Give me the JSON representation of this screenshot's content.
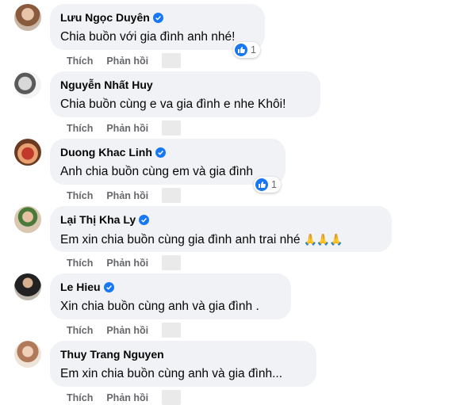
{
  "colors": {
    "bubble": "#f0f2f5",
    "verified": "#1877f2",
    "meta": "#65676b",
    "like": "#1877f2"
  },
  "actions": {
    "like": "Thích",
    "reply": "Phản hồi"
  },
  "comments": [
    {
      "name": "Lưu Ngọc Duyên",
      "verified": true,
      "text": "Chia buồn với gia đình anh nhé!",
      "reactions": "1",
      "emoji": ""
    },
    {
      "name": "Nguyễn Nhất Huy",
      "verified": false,
      "text": "Chia buồn cùng e va gia đình e nhe Khôi!",
      "reactions": "",
      "emoji": ""
    },
    {
      "name": "Duong Khac Linh",
      "verified": true,
      "text": "Anh chia buồn cùng em và gia đình",
      "reactions": "1",
      "emoji": ""
    },
    {
      "name": "Lại Thị Kha Ly",
      "verified": true,
      "text": "Em xin chia buồn cùng gia đình anh trai nhé",
      "reactions": "",
      "emoji": "🙏🙏🙏"
    },
    {
      "name": "Le Hieu",
      "verified": true,
      "text": "Xin chia buồn cùng anh và gia đình .",
      "reactions": "",
      "emoji": ""
    },
    {
      "name": "Thuy Trang Nguyen",
      "verified": false,
      "text": "Em xin chia buồn cùng anh và gia đình...",
      "reactions": "",
      "emoji": ""
    }
  ]
}
